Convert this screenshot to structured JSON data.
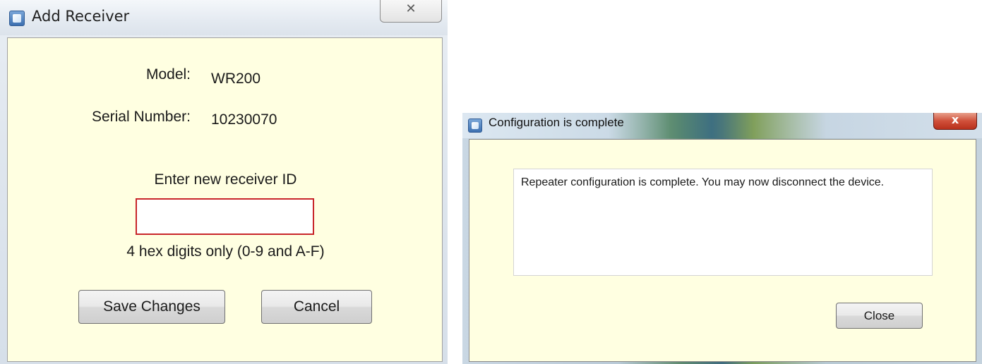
{
  "add_receiver_dialog": {
    "title": "Add Receiver",
    "close_glyph": "✕",
    "model_label": "Model:",
    "model_value": "WR200",
    "serial_label": "Serial Number:",
    "serial_value": "10230070",
    "prompt": "Enter new receiver ID",
    "receiver_id_value": "",
    "hint": "4 hex digits only (0-9 and A-F)",
    "save_label": "Save Changes",
    "cancel_label": "Cancel",
    "colors": {
      "client_background": "#ffffe1",
      "input_error_border": "#c8262a"
    }
  },
  "configuration_dialog": {
    "title": "Configuration is complete",
    "close_glyph": "x",
    "message": "Repeater configuration is complete. You may now disconnect the device.",
    "close_label": "Close",
    "colors": {
      "client_background": "#ffffe1",
      "close_button_red": "#c8402a"
    }
  },
  "icons": {
    "window_icon": "app-window-icon"
  }
}
